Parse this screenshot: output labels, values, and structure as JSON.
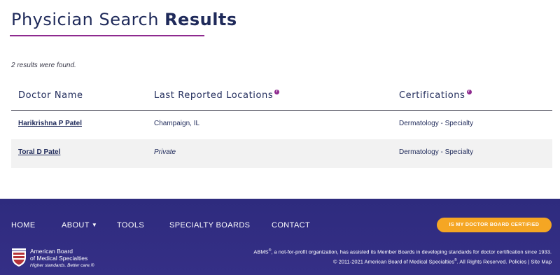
{
  "header": {
    "title_regular": "Physician Search ",
    "title_bold": "Results"
  },
  "results": {
    "count_text": "2 results were found.",
    "columns": [
      {
        "label": "Doctor Name",
        "info": false
      },
      {
        "label": "Last Reported Locations",
        "info": true
      },
      {
        "label": "Certifications",
        "info": true
      }
    ],
    "info_glyph": "i",
    "rows": [
      {
        "name": "Harikrishna P Patel",
        "location": "Champaign, IL",
        "certification": "Dermatology - Specialty"
      },
      {
        "name": "Toral D Patel",
        "location": "Private",
        "certification": "Dermatology - Specialty"
      }
    ]
  },
  "footer": {
    "nav": {
      "home": "HOME",
      "about": "ABOUT",
      "tools": "TOOLS",
      "specialty_boards": "SPECIALTY BOARDS",
      "contact": "CONTACT"
    },
    "cta_label": "IS MY DOCTOR BOARD CERTIFIED",
    "logo": {
      "line1": "American Board",
      "line2": "of Medical Specialties",
      "tagline": "Higher standards. Better care.®"
    },
    "legal_line1_a": "ABMS",
    "legal_line1_b": ", a not-for-profit organization, has assisted its Member Boards in developing standards for doctor certification since 1933.",
    "legal_line2_a": "© 2011-2021 American Board of Medical Specialties",
    "legal_line2_b": ". All Rights Reserved. ",
    "policies_link": "Policies",
    "separator": " | ",
    "sitemap_link": "Site Map",
    "registered_mark": "®"
  },
  "colors": {
    "brand_navy": "#1f2a5a",
    "accent_purple": "#8e2a8f",
    "footer_bg": "#2e2b7e",
    "cta_orange": "#f5a623"
  },
  "icons": {
    "info": "info-icon",
    "about_dropdown": "chevron-down-icon",
    "logo": "abms-logo"
  }
}
